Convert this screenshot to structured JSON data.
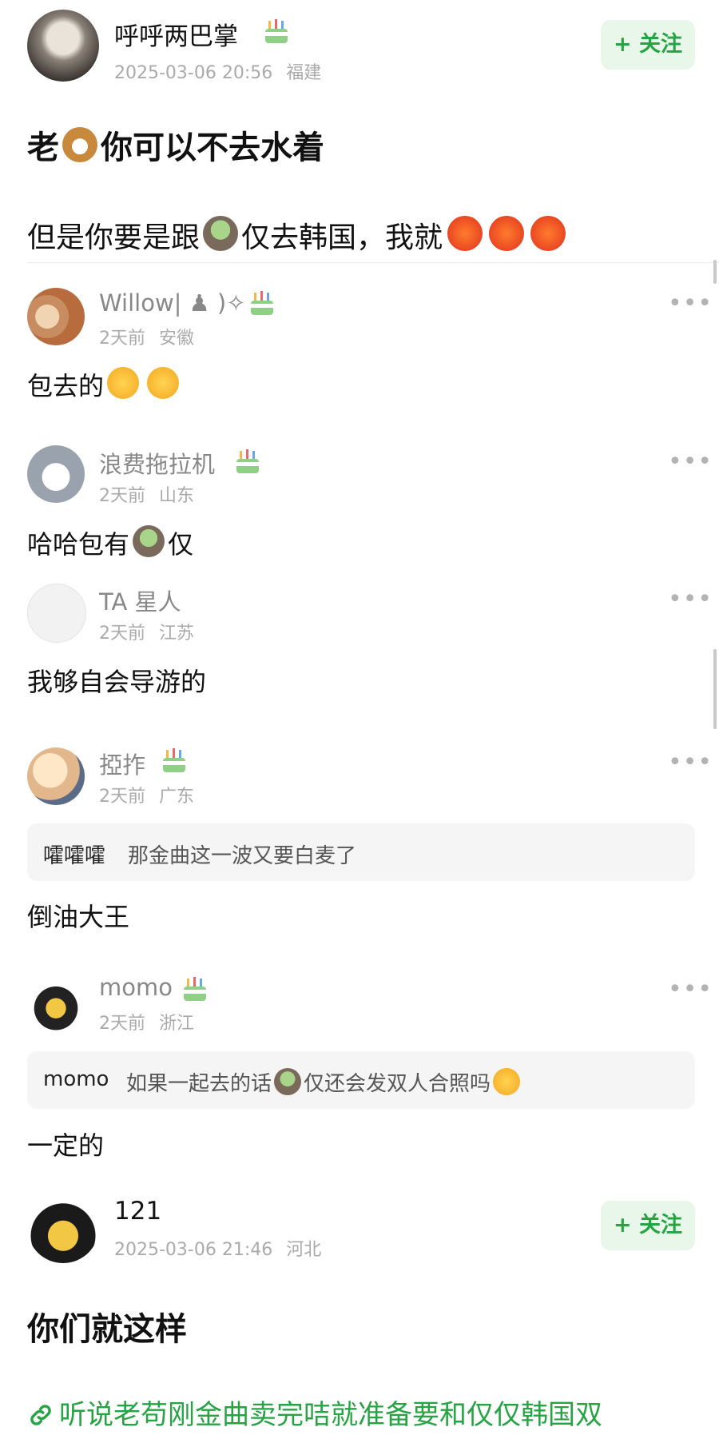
{
  "post": {
    "author": "呼呼两巴掌",
    "datetime": "2025-03-06 20:56",
    "location": "福建",
    "follow_label": "+ 关注",
    "line1_a": "老",
    "line1_b": "你可以不去水着",
    "line2_a": "但是你要是跟",
    "line2_b": "仅去韩国，我就"
  },
  "comments": [
    {
      "name": "Willow| ♟ )✧",
      "time": "2天前",
      "location": "安徽",
      "text": "包去的"
    },
    {
      "name": "浪费拖拉机",
      "time": "2天前",
      "location": "山东",
      "text_a": "哈哈包有",
      "text_b": "仅"
    },
    {
      "name": "TA 星人",
      "time": "2天前",
      "location": "江苏",
      "text": "我够自会导游的"
    },
    {
      "name": "掗拃",
      "time": "2天前",
      "location": "广东",
      "quote_name": "嚯嚯嚯",
      "quote_text": "那金曲这一波又要白麦了",
      "text": "倒油大王"
    },
    {
      "name": "momo",
      "time": "2天前",
      "location": "浙江",
      "quote_name": "momo",
      "quote_text_a": "如果一起去的话",
      "quote_text_b": "仅还会发双人合照吗",
      "text": "一定的"
    }
  ],
  "post2": {
    "author": "121",
    "datetime": "2025-03-06 21:46",
    "location": "河北",
    "follow_label": "+ 关注",
    "title": "你们就这样",
    "link": "听说老苟刚金曲卖完咭就准备要和仅仅韩国双"
  },
  "icons": {
    "more": "more-dots-icon",
    "link": "link-icon",
    "badge": "birthday-cake-badge-icon"
  },
  "colors": {
    "accent": "#26a443",
    "follow_bg": "#e8f7ea",
    "quote_bg": "#f5f5f5"
  }
}
